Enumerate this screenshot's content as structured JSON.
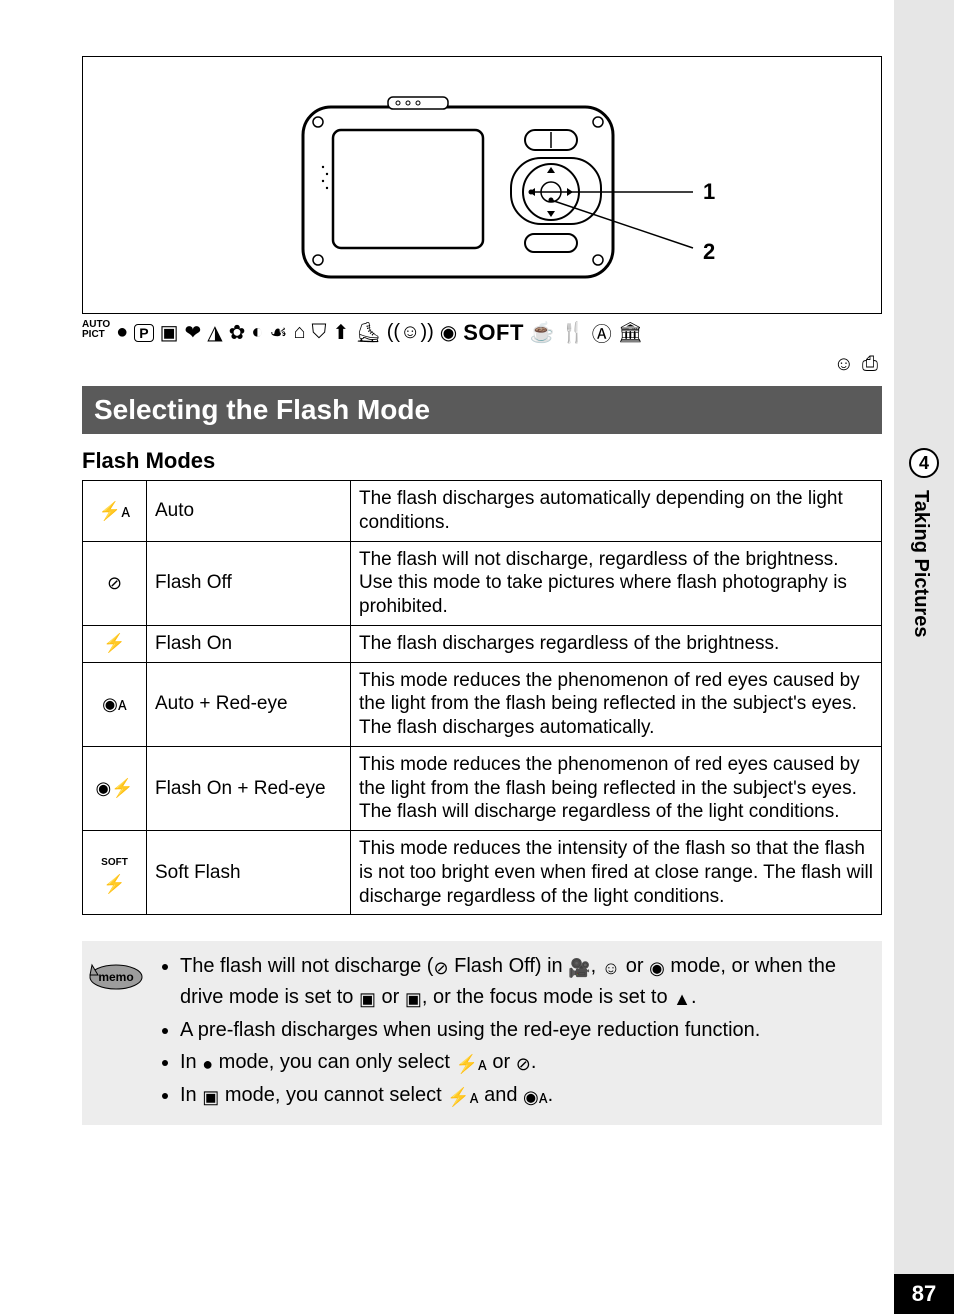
{
  "side": {
    "section_number": "4",
    "section_label": "Taking Pictures",
    "page_number": "87"
  },
  "diagram": {
    "callout1": "1",
    "callout2": "2"
  },
  "mode_icons_row": [
    "▭",
    "●",
    "P",
    "▣",
    "❤",
    "◮",
    "✿",
    "◐",
    "☙",
    "⌂",
    "⛉",
    "⬆",
    "⛸",
    "((☺))",
    "◉"
  ],
  "soft_label": "SOFT",
  "mode_icons_row_tail": [
    "☕",
    "🍴",
    "Ⓐ",
    "🏛"
  ],
  "mode_icons_row2": [
    "☺",
    "⎙"
  ],
  "section_title": "Selecting the Flash Mode",
  "subtitle": "Flash Modes",
  "flash_table": [
    {
      "icon": "⚡ᴀ",
      "name": "Auto",
      "desc": "The flash discharges automatically depending on the light conditions."
    },
    {
      "icon": "⊘",
      "name": "Flash Off",
      "desc": "The flash will not discharge, regardless of the brightness. Use this mode to take pictures where flash photography is prohibited."
    },
    {
      "icon": "⚡",
      "name": "Flash On",
      "desc": "The flash discharges regardless of the brightness."
    },
    {
      "icon": "◉ᴀ",
      "name": "Auto + Red-eye",
      "desc": "This mode reduces the phenomenon of red eyes caused by the light from the flash being reflected in the subject's eyes. The flash discharges automatically."
    },
    {
      "icon": "◉⚡",
      "name": "Flash On + Red-eye",
      "desc": "This mode reduces the phenomenon of red eyes caused by the light from the flash being reflected in the subject's eyes. The flash will discharge regardless of the light conditions."
    },
    {
      "icon": "SOFT⚡",
      "name": "Soft Flash",
      "desc": "This mode reduces the intensity of the flash so that the flash is not too bright even when fired at close range. The flash will discharge regardless of the light conditions."
    }
  ],
  "memo": {
    "label": "memo",
    "bullets": {
      "b1_a": "The flash will not discharge (",
      "b1_b": " Flash Off) in ",
      "b1_c": ", ",
      "b1_d": " or ",
      "b1_e": " mode, or when the drive mode is set to ",
      "b1_f": " or ",
      "b1_g": ", or the focus mode is set to ",
      "b1_h": ".",
      "b2": "A pre-flash discharges when using the red-eye reduction function.",
      "b3_a": "In ",
      "b3_b": " mode, you can only select ",
      "b3_c": " or ",
      "b3_d": ".",
      "b4_a": "In ",
      "b4_b": " mode, you cannot select ",
      "b4_c": " and ",
      "b4_d": "."
    }
  }
}
